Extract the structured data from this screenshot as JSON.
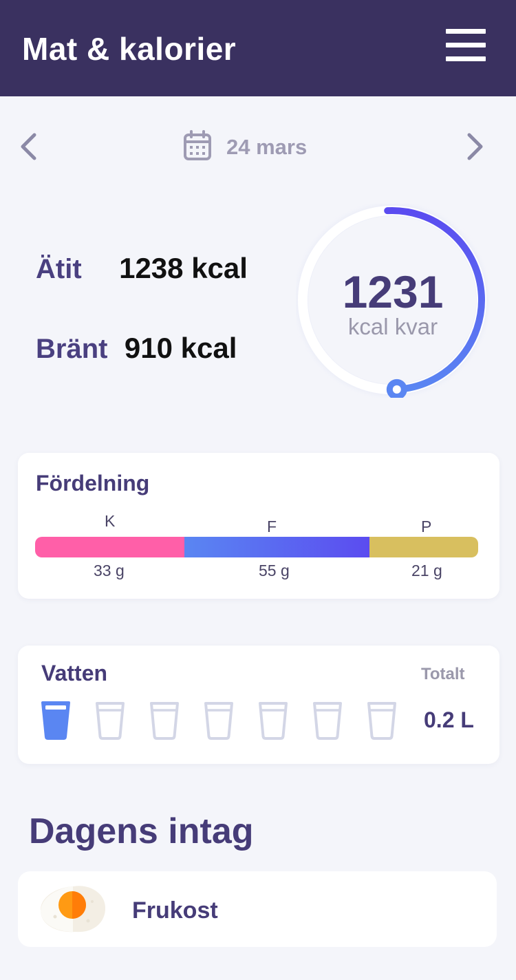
{
  "header": {
    "title": "Mat & kalorier",
    "menu_icon": "hamburger-menu-icon"
  },
  "date_nav": {
    "date": "24 mars",
    "prev_icon": "chevron-left-icon",
    "next_icon": "chevron-right-icon",
    "calendar_icon": "calendar-icon"
  },
  "summary": {
    "eaten_label": "Ätit",
    "eaten_value": "1238 kcal",
    "burned_label": "Bränt",
    "burned_value": "910 kcal",
    "remaining_value": "1231",
    "remaining_unit": "kcal kvar",
    "ring_progress": 0.5
  },
  "distribution": {
    "title": "Fördelning",
    "macros": [
      {
        "letter": "K",
        "amount": "33 g",
        "color": "#ff5fa8"
      },
      {
        "letter": "F",
        "amount": "55 g",
        "color": "#5a5cf0"
      },
      {
        "letter": "P",
        "amount": "21 g",
        "color": "#d8bf5f"
      }
    ]
  },
  "water": {
    "title": "Vatten",
    "total_label": "Totalt",
    "total_value": "0.2 L",
    "glasses_total": 7,
    "glasses_filled": 1,
    "filled_color": "#5a86f2",
    "empty_color": "#d3d6e6"
  },
  "intake": {
    "title": "Dagens intag",
    "meals": [
      {
        "label": "Frukost",
        "icon": "fried-egg-icon"
      }
    ]
  },
  "colors": {
    "header_bg": "#3a3160",
    "accent": "#463c78",
    "ring_start": "#5b4cf0",
    "ring_end": "#5a86f2"
  }
}
